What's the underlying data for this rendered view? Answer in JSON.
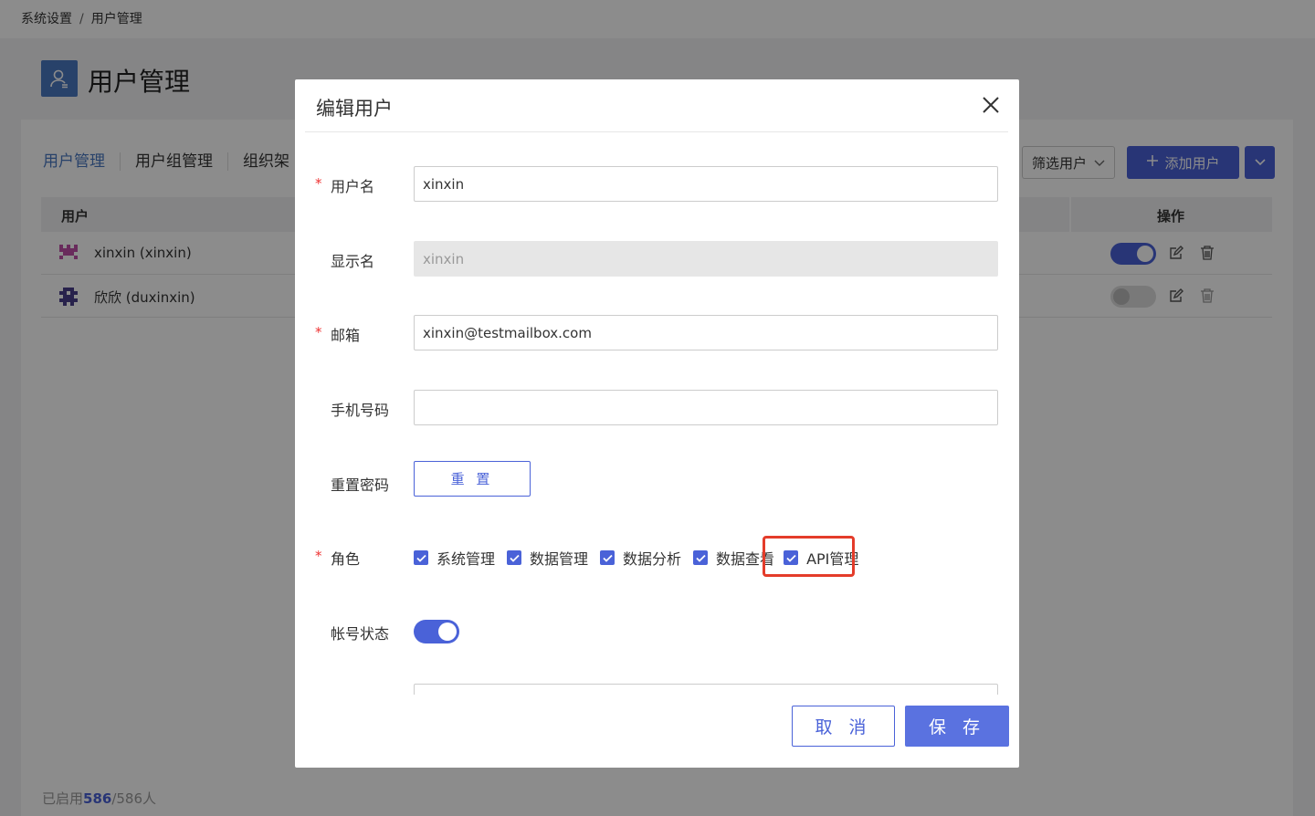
{
  "breadcrumb": {
    "root": "系统设置",
    "separator": "/",
    "current": "用户管理"
  },
  "page": {
    "title": "用户管理"
  },
  "tabs": [
    "用户管理",
    "用户组管理",
    "组织架"
  ],
  "toolbar": {
    "filter_label": "筛选用户",
    "add_label": "添加用户"
  },
  "table": {
    "headers": {
      "user": "用户",
      "actions": "操作"
    },
    "rows": [
      {
        "name": "xinxin (xinxin)",
        "enabled": true
      },
      {
        "name": "欣欣 (duxinxin)",
        "enabled": false
      }
    ]
  },
  "footer": {
    "prefix": "已启用",
    "enabled_count": "586",
    "suffix": "/586人"
  },
  "modal": {
    "title": "编辑用户",
    "fields": {
      "username": {
        "label": "用户名",
        "value": "xinxin",
        "required": true
      },
      "display_name": {
        "label": "显示名",
        "value": "xinxin"
      },
      "email": {
        "label": "邮箱",
        "value": "xinxin@testmailbox.com",
        "required": true
      },
      "phone": {
        "label": "手机号码",
        "value": ""
      },
      "reset_password": {
        "label": "重置密码",
        "button": "重 置"
      },
      "roles": {
        "label": "角色",
        "options": [
          "系统管理",
          "数据管理",
          "数据分析",
          "数据查看",
          "API管理"
        ],
        "checked": [
          true,
          true,
          true,
          true,
          true
        ],
        "required": true
      },
      "account_status": {
        "label": "帐号状态",
        "enabled": true
      }
    },
    "required_mark": "*",
    "cancel_label": "取 消",
    "save_label": "保 存"
  },
  "colors": {
    "accent": "#4a62d8",
    "highlight": "#e43c2a"
  }
}
